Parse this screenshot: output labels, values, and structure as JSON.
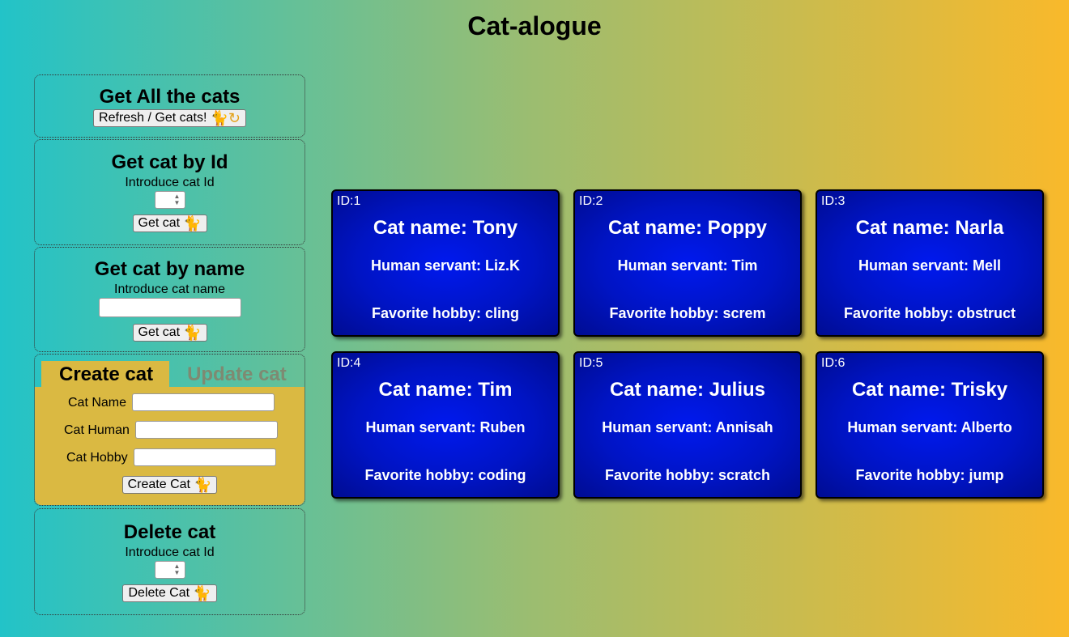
{
  "page": {
    "title": "Cat-alogue"
  },
  "get_all": {
    "heading": "Get All the cats",
    "button_label": "Refresh / Get cats!",
    "button_icons": "🐈↻"
  },
  "get_by_id": {
    "heading": "Get cat by Id",
    "instruction": "Introduce cat Id",
    "id_value": "",
    "button_label": "Get cat",
    "button_icon": "🐈"
  },
  "get_by_name": {
    "heading": "Get cat by name",
    "instruction": "Introduce cat name",
    "name_value": "",
    "button_label": "Get cat",
    "button_icon": "🐈"
  },
  "create_update": {
    "tabs": [
      {
        "label": "Create cat",
        "active": true
      },
      {
        "label": "Update cat",
        "active": false
      }
    ],
    "fields": [
      {
        "label": "Cat Name",
        "value": ""
      },
      {
        "label": "Cat Human",
        "value": ""
      },
      {
        "label": "Cat Hobby",
        "value": ""
      }
    ],
    "button_label": "Create Cat",
    "button_icon": "🐈"
  },
  "delete": {
    "heading": "Delete cat",
    "instruction": "Introduce cat Id",
    "id_value": "",
    "button_label": "Delete Cat",
    "button_icon": "🐈"
  },
  "cats": [
    {
      "id": "ID:1",
      "name": "Cat name: Tony",
      "human": "Human servant: Liz.K",
      "hobby": "Favorite hobby: cling"
    },
    {
      "id": "ID:2",
      "name": "Cat name: Poppy",
      "human": "Human servant: Tim",
      "hobby": "Favorite hobby: screm"
    },
    {
      "id": "ID:3",
      "name": "Cat name: Narla",
      "human": "Human servant: Mell",
      "hobby": "Favorite hobby: obstruct"
    },
    {
      "id": "ID:4",
      "name": "Cat name: Tim",
      "human": "Human servant: Ruben",
      "hobby": "Favorite hobby: coding"
    },
    {
      "id": "ID:5",
      "name": "Cat name: Julius",
      "human": "Human servant: Annisah",
      "hobby": "Favorite hobby: scratch"
    },
    {
      "id": "ID:6",
      "name": "Cat name: Trisky",
      "human": "Human servant: Alberto",
      "hobby": "Favorite hobby: jump"
    }
  ],
  "colors": {
    "gradient_left": "#22c3c8",
    "gradient_right": "#f9b92b",
    "form_background": "#dab942",
    "card_blue": "#0019ee"
  }
}
